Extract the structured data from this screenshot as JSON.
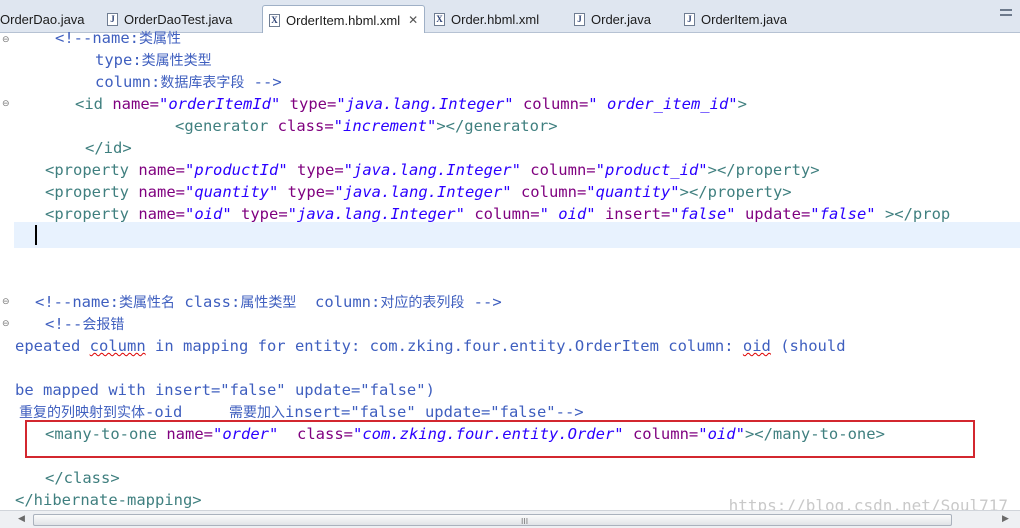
{
  "tabs": [
    {
      "label": "OrderDao.java",
      "icon": "java-file-icon",
      "icon_glyph": "J"
    },
    {
      "label": "OrderDaoTest.java",
      "icon": "java-file-icon",
      "icon_glyph": "J"
    },
    {
      "label": "OrderItem.hbml.xml",
      "icon": "xml-file-icon",
      "icon_glyph": "X",
      "active": true,
      "close": "✕"
    },
    {
      "label": "Order.hbml.xml",
      "icon": "xml-file-icon",
      "icon_glyph": "X"
    },
    {
      "label": "Order.java",
      "icon": "java-file-icon",
      "icon_glyph": "J"
    },
    {
      "label": "OrderItem.java",
      "icon": "java-file-icon",
      "icon_glyph": "J"
    }
  ],
  "code": {
    "l1": {
      "a": "<!--name:",
      "b": "类属性"
    },
    "l2": {
      "a": "type:",
      "b": "类属性类型"
    },
    "l3": {
      "a": "column:",
      "b": "数据库表字段",
      "c": " -->"
    },
    "l4": {
      "t1": "<id ",
      "a1": "name=",
      "v1": "\"orderItemId\"",
      "a2": " type=",
      "v2": "\"java.lang.Integer\"",
      "a3": " column=",
      "v3": "\" order_item_id\"",
      "t2": ">"
    },
    "l5": {
      "t1": "<generator ",
      "a1": "class=",
      "v1": "\"increment\"",
      "t2": "></generator>"
    },
    "l6": {
      "t1": "</id>"
    },
    "l7": {
      "t1": "<property ",
      "a1": "name=",
      "v1": "\"productId\"",
      "a2": " type=",
      "v2": "\"java.lang.Integer\"",
      "a3": " column=",
      "v3": "\"product_id\"",
      "t2": "></property>"
    },
    "l8": {
      "t1": "<property ",
      "a1": "name=",
      "v1": "\"quantity\"",
      "a2": " type=",
      "v2": "\"java.lang.Integer\"",
      "a3": " column=",
      "v3": "\"quantity\"",
      "t2": "></property>"
    },
    "l9": {
      "t1": "<property ",
      "a1": "name=",
      "v1": "\"oid\"",
      "a2": " type=",
      "v2": "\"java.lang.Integer\"",
      "a3": " column=",
      "v3": "\" oid\"",
      "a4": " insert=",
      "v4": "\"false\"",
      "a5": " update=",
      "v5": "\"false\"",
      "t2": " ></prop"
    },
    "l10": {
      "a": "<!--name:",
      "b": "类属性名",
      "c": " class:",
      "d": "属性类型",
      "e": "  column:",
      "f": "对应的表列段",
      "g": " -->"
    },
    "l11": {
      "a": "<!--",
      "b": "会报错"
    },
    "l12": {
      "a": "epeated ",
      "b": "column",
      "c": " in mapping for entity: com.zking.four.entity.OrderItem column: ",
      "d": "oid",
      "e": " (should"
    },
    "l13": {
      "a": "be mapped with insert=\"false\" update=\"false\")"
    },
    "l14": {
      "a": "重复的列映射到实体",
      "b": "-oid",
      "c": "     ",
      "d": "需要加入",
      "e": "insert=\"false\" update=\"false\"-->"
    },
    "l15": {
      "t1": "<many-to-one ",
      "a1": "name=",
      "v1": "\"order\"",
      "a2": "  class=",
      "v2": "\"com.zking.four.entity.Order\"",
      "a3": " column=",
      "v3": "\"oid\"",
      "t2": "></many-to-one>"
    },
    "l16": {
      "t1": "</class>"
    },
    "l17": {
      "t1": "</hibernate-mapping>"
    }
  },
  "watermark": "https://blog.csdn.net/Soul717",
  "scroll": {
    "left": "◀",
    "right": "▶",
    "grip": "III"
  },
  "colors": {
    "tag": "#3f7f7f",
    "attribute": "#7f007f",
    "value": "#2a00ff",
    "comment": "#3f5fbf",
    "highlight_box": "#d3272f"
  }
}
